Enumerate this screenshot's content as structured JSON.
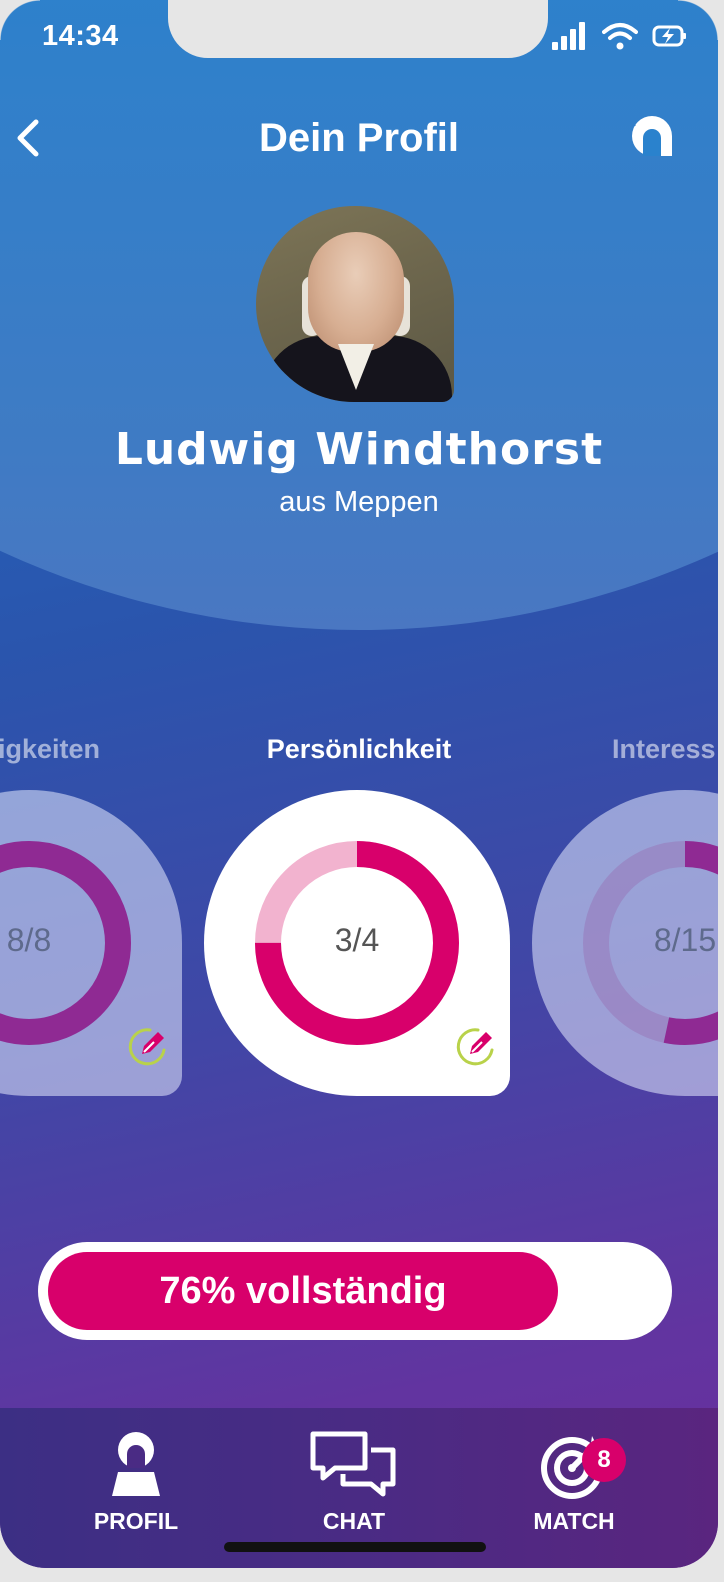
{
  "status_bar": {
    "time": "14:34"
  },
  "header": {
    "title": "Dein Profil"
  },
  "profile": {
    "name": "Ludwig Windthorst",
    "origin": "aus Meppen"
  },
  "categories": [
    {
      "label": "igkeiten",
      "count": "8/8",
      "completed": 8,
      "total": 8,
      "active": false
    },
    {
      "label": "Persönlichkeit",
      "count": "3/4",
      "completed": 3,
      "total": 4,
      "active": true
    },
    {
      "label": "Interess",
      "count": "8/15",
      "completed": 8,
      "total": 15,
      "active": false
    }
  ],
  "progress": {
    "percent": 76,
    "label": "76% vollständig"
  },
  "nav": {
    "profil": "PROFIL",
    "chat": "CHAT",
    "match": "MATCH",
    "match_badge": "8"
  },
  "colors": {
    "accent": "#d8006b",
    "accent_light": "#f2b3cf",
    "purple": "#8f2a93",
    "edit_green": "#b9d24a"
  }
}
